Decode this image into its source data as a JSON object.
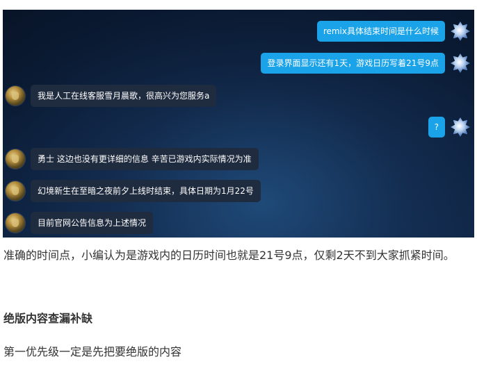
{
  "chat": {
    "messages": [
      {
        "side": "out",
        "text": "remix具体结束时间是什么时候"
      },
      {
        "side": "out",
        "text": "登录界面显示还有1天，游戏日历写着21号9点"
      },
      {
        "side": "in",
        "text": "我是人工在线客服雪月晨歌，很高兴为您服务a"
      },
      {
        "side": "out",
        "text": "?"
      },
      {
        "side": "in",
        "text": "勇士 这边也没有更详细的信息 辛苦已游戏内实际情况为准"
      },
      {
        "side": "in",
        "text": "幻境新生在至暗之夜前夕上线时结束，具体日期为1月22号"
      },
      {
        "side": "in",
        "text": "目前官网公告信息为上述情况"
      }
    ]
  },
  "article": {
    "paragraph1": "准确的时间点，小编认为是游戏内的日历时间也就是21号9点，仅剩2天不到大家抓紧时间。",
    "heading": "绝版内容查漏补缺",
    "paragraph2": "第一优先级一定是先把要绝版的内容"
  },
  "colors": {
    "chat_background": "#0b1c36",
    "outgoing_bubble": "#1aa3e8",
    "incoming_bubble": "#1f2b3e",
    "body_text": "#333333"
  }
}
